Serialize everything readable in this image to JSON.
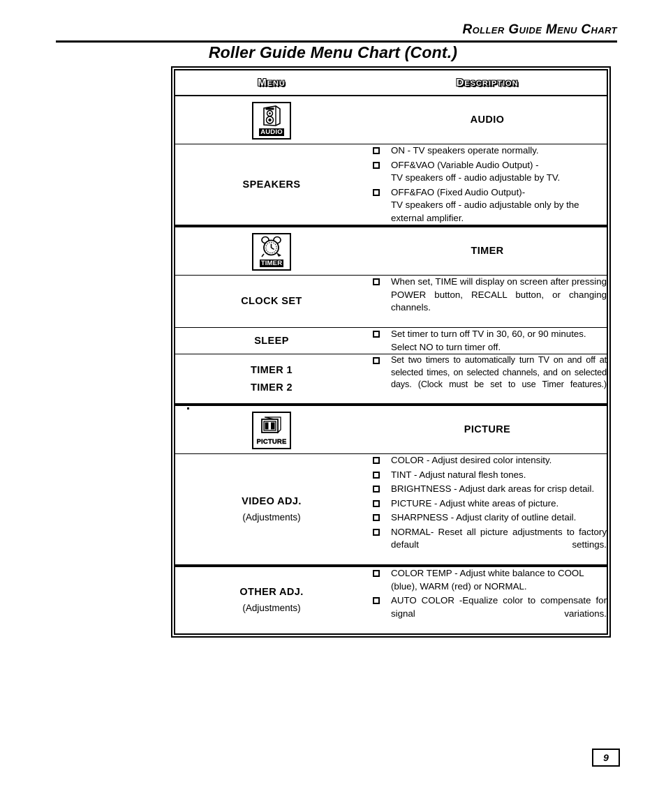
{
  "header": {
    "running_title": "Roller Guide Menu Chart",
    "doc_title": "Roller Guide Menu Chart (Cont.)"
  },
  "table": {
    "columns": [
      "Menu",
      "Description"
    ],
    "sections": [
      {
        "id": "audio",
        "icon": {
          "name": "audio-speaker-icon",
          "caption": "AUDIO"
        },
        "heading": "AUDIO",
        "rows": [
          {
            "label": "SPEAKERS",
            "sub": "",
            "bullets": [
              "ON - TV speakers operate normally.",
              "OFF&VAO (Variable Audio Output) -\nTV speakers off - audio adjustable by TV.",
              "OFF&FAO (Fixed Audio Output)-\nTV speakers off - audio adjustable only by the external amplifier."
            ]
          }
        ]
      },
      {
        "id": "timer",
        "icon": {
          "name": "alarm-clock-icon",
          "caption": "TIMER"
        },
        "heading": "TIMER",
        "rows": [
          {
            "label": "CLOCK SET",
            "sub": "",
            "bullets": [
              "When set, TIME will display on screen after pressing POWER button, RECALL button, or changing channels."
            ]
          },
          {
            "label": "SLEEP",
            "sub": "",
            "bullets": [
              "Set timer to turn off TV in 30, 60, or 90 minutes. Select NO to turn timer off."
            ]
          },
          {
            "label": "TIMER 1",
            "label2": "TIMER 2",
            "sub": "",
            "bullets": [
              "Set two timers to automatically turn TV on and off at selected times, on selected channels, and on selected days.  (Clock must be set to use Timer features.)"
            ]
          }
        ]
      },
      {
        "id": "picture",
        "icon": {
          "name": "television-icon",
          "caption": "PICTURE"
        },
        "heading": "PICTURE",
        "rows": [
          {
            "label": "VIDEO ADJ.",
            "sub": "(Adjustments)",
            "bullets": [
              "COLOR - Adjust desired color intensity.",
              "TINT - Adjust natural flesh tones.",
              "BRIGHTNESS - Adjust dark areas for crisp detail.",
              "PICTURE - Adjust white areas of picture.",
              "SHARPNESS - Adjust clarity of outline detail.",
              "NORMAL- Reset all picture adjustments to factory default settings."
            ]
          },
          {
            "label": "OTHER ADJ.",
            "sub": "(Adjustments)",
            "bullets": [
              "COLOR TEMP - Adjust white balance to COOL (blue), WARM (red) or NORMAL.",
              "AUTO COLOR -Equalize color to compensate for signal variations."
            ]
          }
        ]
      }
    ]
  },
  "footer": {
    "page_number": "9"
  }
}
